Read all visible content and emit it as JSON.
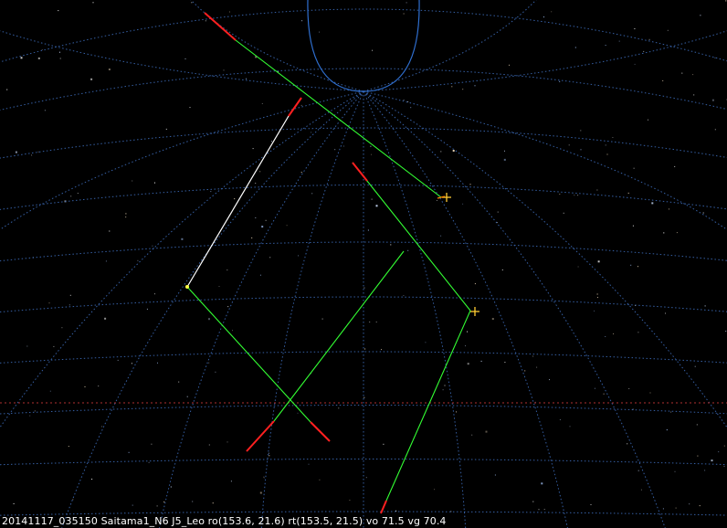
{
  "caption": "20141117_035150 Saitama1_N6 J5_Leo ro(153.6, 21.6) rt(153.5, 21.5) vo 71.5 vg 70.4",
  "colors": {
    "background": "#000000",
    "grid": "#3f6fbf",
    "zenith_circle": "#2f6fd0",
    "horizon": "#b03030",
    "track_observed": "#ffffff",
    "track_projection": "#33ff33",
    "track_head": "#ff2020",
    "marker": "#ffcc33",
    "caption_text": "#ffffff"
  }
}
